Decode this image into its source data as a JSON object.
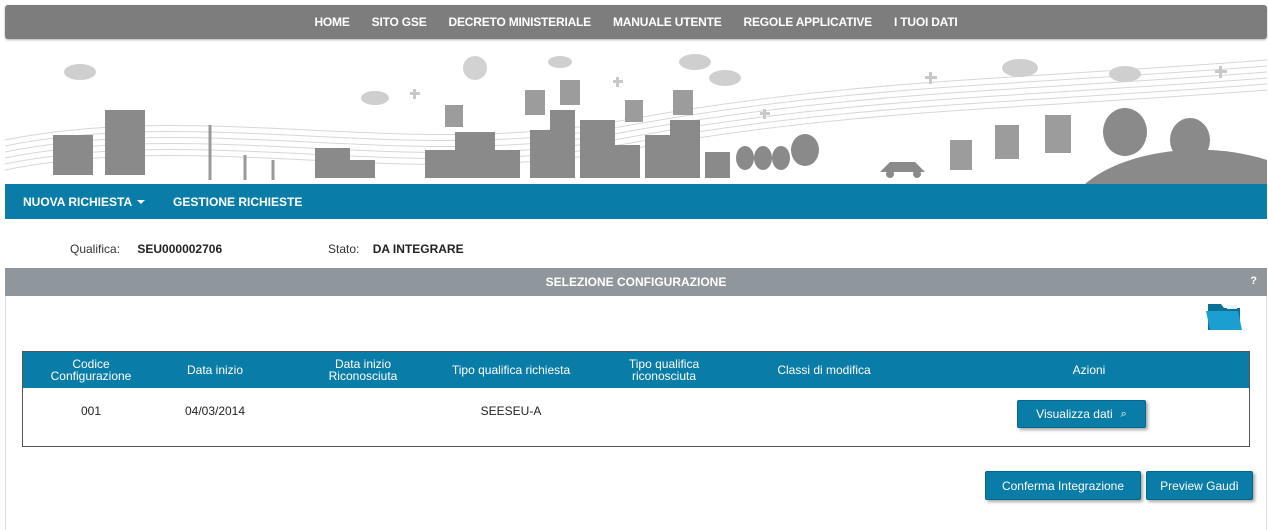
{
  "topnav": {
    "items": [
      "HOME",
      "SITO GSE",
      "DECRETO MINISTERIALE",
      "MANUALE UTENTE",
      "REGOLE APPLICATIVE",
      "I TUOI DATI"
    ]
  },
  "menu": {
    "nuova_richiesta": "NUOVA RICHIESTA",
    "gestione_richieste": "GESTIONE RICHIESTE"
  },
  "info": {
    "qualifica_label": "Qualifica:",
    "qualifica_value": "SEU000002706",
    "stato_label": "Stato:",
    "stato_value": "DA INTEGRARE"
  },
  "section": {
    "title": "SELEZIONE CONFIGURAZIONE",
    "help": "?"
  },
  "table": {
    "headers": [
      "Codice\nConfigurazione",
      "Data inizio",
      "Data inizio\nRiconosciuta",
      "Tipo qualifica richiesta",
      "Tipo qualifica\nriconosciuta",
      "Classi di modifica",
      "Azioni"
    ],
    "rows": [
      {
        "codice": "001",
        "data_inizio": "04/03/2014",
        "data_riconosciuta": "",
        "tipo_richiesta": "SEESEU-A",
        "tipo_riconosciuta": "",
        "classi": "",
        "action_label": "Visualizza dati"
      }
    ]
  },
  "buttons": {
    "conferma": "Conferma Integrazione",
    "preview": "Preview Gaudì"
  },
  "colors": {
    "accent": "#0a7ca8",
    "nav_gray": "#7d7d7d",
    "header_gray": "#8f979c"
  }
}
